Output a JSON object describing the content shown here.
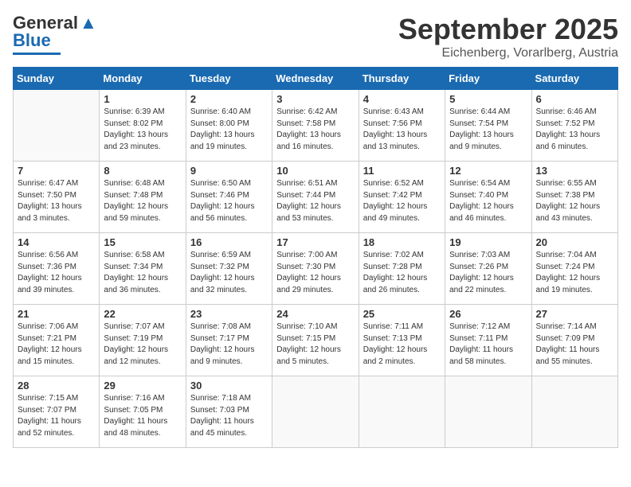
{
  "header": {
    "logo_general": "General",
    "logo_blue": "Blue",
    "month_title": "September 2025",
    "location": "Eichenberg, Vorarlberg, Austria"
  },
  "days_of_week": [
    "Sunday",
    "Monday",
    "Tuesday",
    "Wednesday",
    "Thursday",
    "Friday",
    "Saturday"
  ],
  "weeks": [
    [
      {
        "day": "",
        "sunrise": "",
        "sunset": "",
        "daylight": ""
      },
      {
        "day": "1",
        "sunrise": "Sunrise: 6:39 AM",
        "sunset": "Sunset: 8:02 PM",
        "daylight": "Daylight: 13 hours and 23 minutes."
      },
      {
        "day": "2",
        "sunrise": "Sunrise: 6:40 AM",
        "sunset": "Sunset: 8:00 PM",
        "daylight": "Daylight: 13 hours and 19 minutes."
      },
      {
        "day": "3",
        "sunrise": "Sunrise: 6:42 AM",
        "sunset": "Sunset: 7:58 PM",
        "daylight": "Daylight: 13 hours and 16 minutes."
      },
      {
        "day": "4",
        "sunrise": "Sunrise: 6:43 AM",
        "sunset": "Sunset: 7:56 PM",
        "daylight": "Daylight: 13 hours and 13 minutes."
      },
      {
        "day": "5",
        "sunrise": "Sunrise: 6:44 AM",
        "sunset": "Sunset: 7:54 PM",
        "daylight": "Daylight: 13 hours and 9 minutes."
      },
      {
        "day": "6",
        "sunrise": "Sunrise: 6:46 AM",
        "sunset": "Sunset: 7:52 PM",
        "daylight": "Daylight: 13 hours and 6 minutes."
      }
    ],
    [
      {
        "day": "7",
        "sunrise": "Sunrise: 6:47 AM",
        "sunset": "Sunset: 7:50 PM",
        "daylight": "Daylight: 13 hours and 3 minutes."
      },
      {
        "day": "8",
        "sunrise": "Sunrise: 6:48 AM",
        "sunset": "Sunset: 7:48 PM",
        "daylight": "Daylight: 12 hours and 59 minutes."
      },
      {
        "day": "9",
        "sunrise": "Sunrise: 6:50 AM",
        "sunset": "Sunset: 7:46 PM",
        "daylight": "Daylight: 12 hours and 56 minutes."
      },
      {
        "day": "10",
        "sunrise": "Sunrise: 6:51 AM",
        "sunset": "Sunset: 7:44 PM",
        "daylight": "Daylight: 12 hours and 53 minutes."
      },
      {
        "day": "11",
        "sunrise": "Sunrise: 6:52 AM",
        "sunset": "Sunset: 7:42 PM",
        "daylight": "Daylight: 12 hours and 49 minutes."
      },
      {
        "day": "12",
        "sunrise": "Sunrise: 6:54 AM",
        "sunset": "Sunset: 7:40 PM",
        "daylight": "Daylight: 12 hours and 46 minutes."
      },
      {
        "day": "13",
        "sunrise": "Sunrise: 6:55 AM",
        "sunset": "Sunset: 7:38 PM",
        "daylight": "Daylight: 12 hours and 43 minutes."
      }
    ],
    [
      {
        "day": "14",
        "sunrise": "Sunrise: 6:56 AM",
        "sunset": "Sunset: 7:36 PM",
        "daylight": "Daylight: 12 hours and 39 minutes."
      },
      {
        "day": "15",
        "sunrise": "Sunrise: 6:58 AM",
        "sunset": "Sunset: 7:34 PM",
        "daylight": "Daylight: 12 hours and 36 minutes."
      },
      {
        "day": "16",
        "sunrise": "Sunrise: 6:59 AM",
        "sunset": "Sunset: 7:32 PM",
        "daylight": "Daylight: 12 hours and 32 minutes."
      },
      {
        "day": "17",
        "sunrise": "Sunrise: 7:00 AM",
        "sunset": "Sunset: 7:30 PM",
        "daylight": "Daylight: 12 hours and 29 minutes."
      },
      {
        "day": "18",
        "sunrise": "Sunrise: 7:02 AM",
        "sunset": "Sunset: 7:28 PM",
        "daylight": "Daylight: 12 hours and 26 minutes."
      },
      {
        "day": "19",
        "sunrise": "Sunrise: 7:03 AM",
        "sunset": "Sunset: 7:26 PM",
        "daylight": "Daylight: 12 hours and 22 minutes."
      },
      {
        "day": "20",
        "sunrise": "Sunrise: 7:04 AM",
        "sunset": "Sunset: 7:24 PM",
        "daylight": "Daylight: 12 hours and 19 minutes."
      }
    ],
    [
      {
        "day": "21",
        "sunrise": "Sunrise: 7:06 AM",
        "sunset": "Sunset: 7:21 PM",
        "daylight": "Daylight: 12 hours and 15 minutes."
      },
      {
        "day": "22",
        "sunrise": "Sunrise: 7:07 AM",
        "sunset": "Sunset: 7:19 PM",
        "daylight": "Daylight: 12 hours and 12 minutes."
      },
      {
        "day": "23",
        "sunrise": "Sunrise: 7:08 AM",
        "sunset": "Sunset: 7:17 PM",
        "daylight": "Daylight: 12 hours and 9 minutes."
      },
      {
        "day": "24",
        "sunrise": "Sunrise: 7:10 AM",
        "sunset": "Sunset: 7:15 PM",
        "daylight": "Daylight: 12 hours and 5 minutes."
      },
      {
        "day": "25",
        "sunrise": "Sunrise: 7:11 AM",
        "sunset": "Sunset: 7:13 PM",
        "daylight": "Daylight: 12 hours and 2 minutes."
      },
      {
        "day": "26",
        "sunrise": "Sunrise: 7:12 AM",
        "sunset": "Sunset: 7:11 PM",
        "daylight": "Daylight: 11 hours and 58 minutes."
      },
      {
        "day": "27",
        "sunrise": "Sunrise: 7:14 AM",
        "sunset": "Sunset: 7:09 PM",
        "daylight": "Daylight: 11 hours and 55 minutes."
      }
    ],
    [
      {
        "day": "28",
        "sunrise": "Sunrise: 7:15 AM",
        "sunset": "Sunset: 7:07 PM",
        "daylight": "Daylight: 11 hours and 52 minutes."
      },
      {
        "day": "29",
        "sunrise": "Sunrise: 7:16 AM",
        "sunset": "Sunset: 7:05 PM",
        "daylight": "Daylight: 11 hours and 48 minutes."
      },
      {
        "day": "30",
        "sunrise": "Sunrise: 7:18 AM",
        "sunset": "Sunset: 7:03 PM",
        "daylight": "Daylight: 11 hours and 45 minutes."
      },
      {
        "day": "",
        "sunrise": "",
        "sunset": "",
        "daylight": ""
      },
      {
        "day": "",
        "sunrise": "",
        "sunset": "",
        "daylight": ""
      },
      {
        "day": "",
        "sunrise": "",
        "sunset": "",
        "daylight": ""
      },
      {
        "day": "",
        "sunrise": "",
        "sunset": "",
        "daylight": ""
      }
    ]
  ]
}
